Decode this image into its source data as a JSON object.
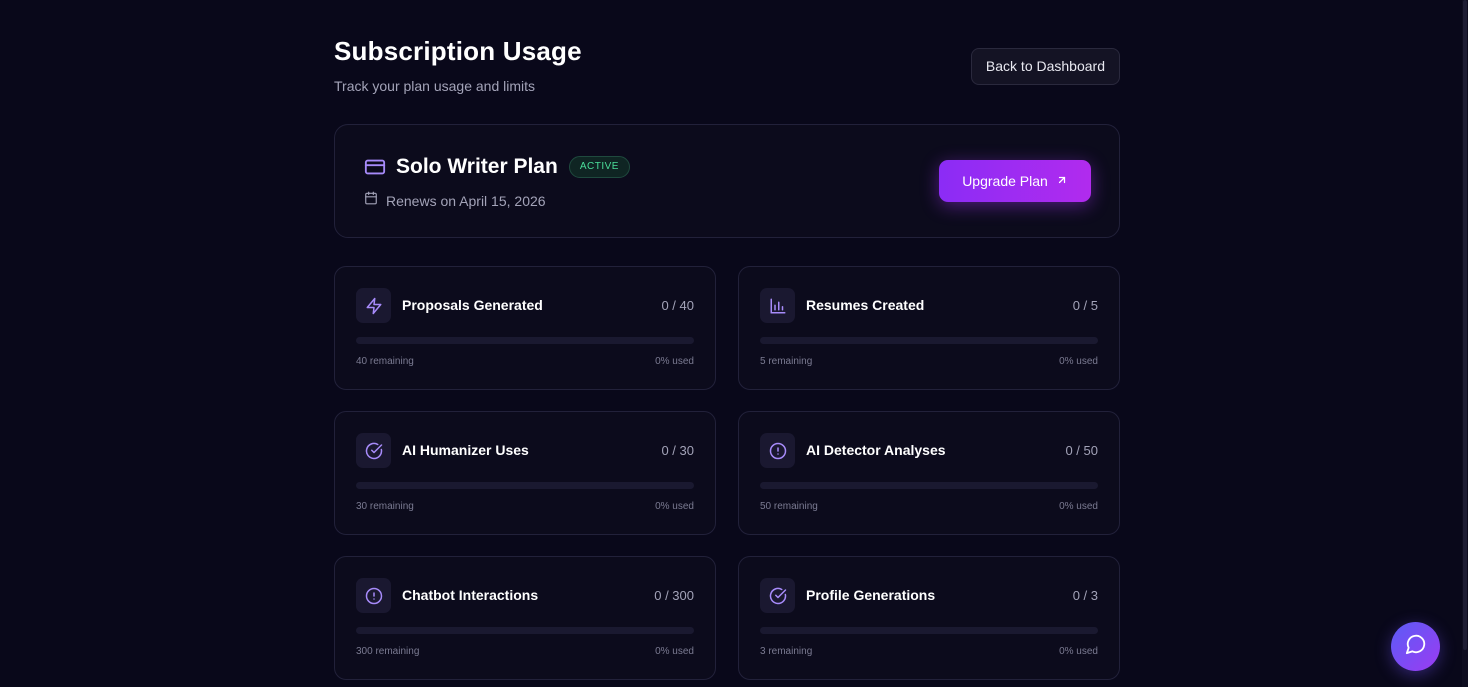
{
  "header": {
    "title": "Subscription Usage",
    "subtitle": "Track your plan usage and limits",
    "back_button": "Back to Dashboard"
  },
  "plan": {
    "icon": "credit-card-icon",
    "name": "Solo Writer Plan",
    "status_badge": "ACTIVE",
    "renews_icon": "calendar-icon",
    "renews_text": "Renews on April 15, 2026",
    "upgrade_button": "Upgrade Plan",
    "upgrade_icon": "arrow-up-right-icon"
  },
  "usage": [
    {
      "icon": "lightning-bolt-icon",
      "title": "Proposals Generated",
      "count": "0 / 40",
      "remaining": "40 remaining",
      "used": "0% used",
      "progress": 0
    },
    {
      "icon": "bar-chart-icon",
      "title": "Resumes Created",
      "count": "0 / 5",
      "remaining": "5 remaining",
      "used": "0% used",
      "progress": 0
    },
    {
      "icon": "check-circle-icon",
      "title": "AI Humanizer Uses",
      "count": "0 / 30",
      "remaining": "30 remaining",
      "used": "0% used",
      "progress": 0
    },
    {
      "icon": "alert-circle-icon",
      "title": "AI Detector Analyses",
      "count": "0 / 50",
      "remaining": "50 remaining",
      "used": "0% used",
      "progress": 0
    },
    {
      "icon": "alert-circle-icon",
      "title": "Chatbot Interactions",
      "count": "0 / 300",
      "remaining": "300 remaining",
      "used": "0% used",
      "progress": 0
    },
    {
      "icon": "check-circle-icon",
      "title": "Profile Generations",
      "count": "0 / 3",
      "remaining": "3 remaining",
      "used": "0% used",
      "progress": 0
    }
  ],
  "chat": {
    "icon": "chat-bubble-icon"
  },
  "colors": {
    "background": "#09081a",
    "accent": "#8b5cf6",
    "upgrade_gradient_start": "#8b2cf5",
    "upgrade_gradient_end": "#b12bee",
    "active_badge": "#4ade9a"
  }
}
